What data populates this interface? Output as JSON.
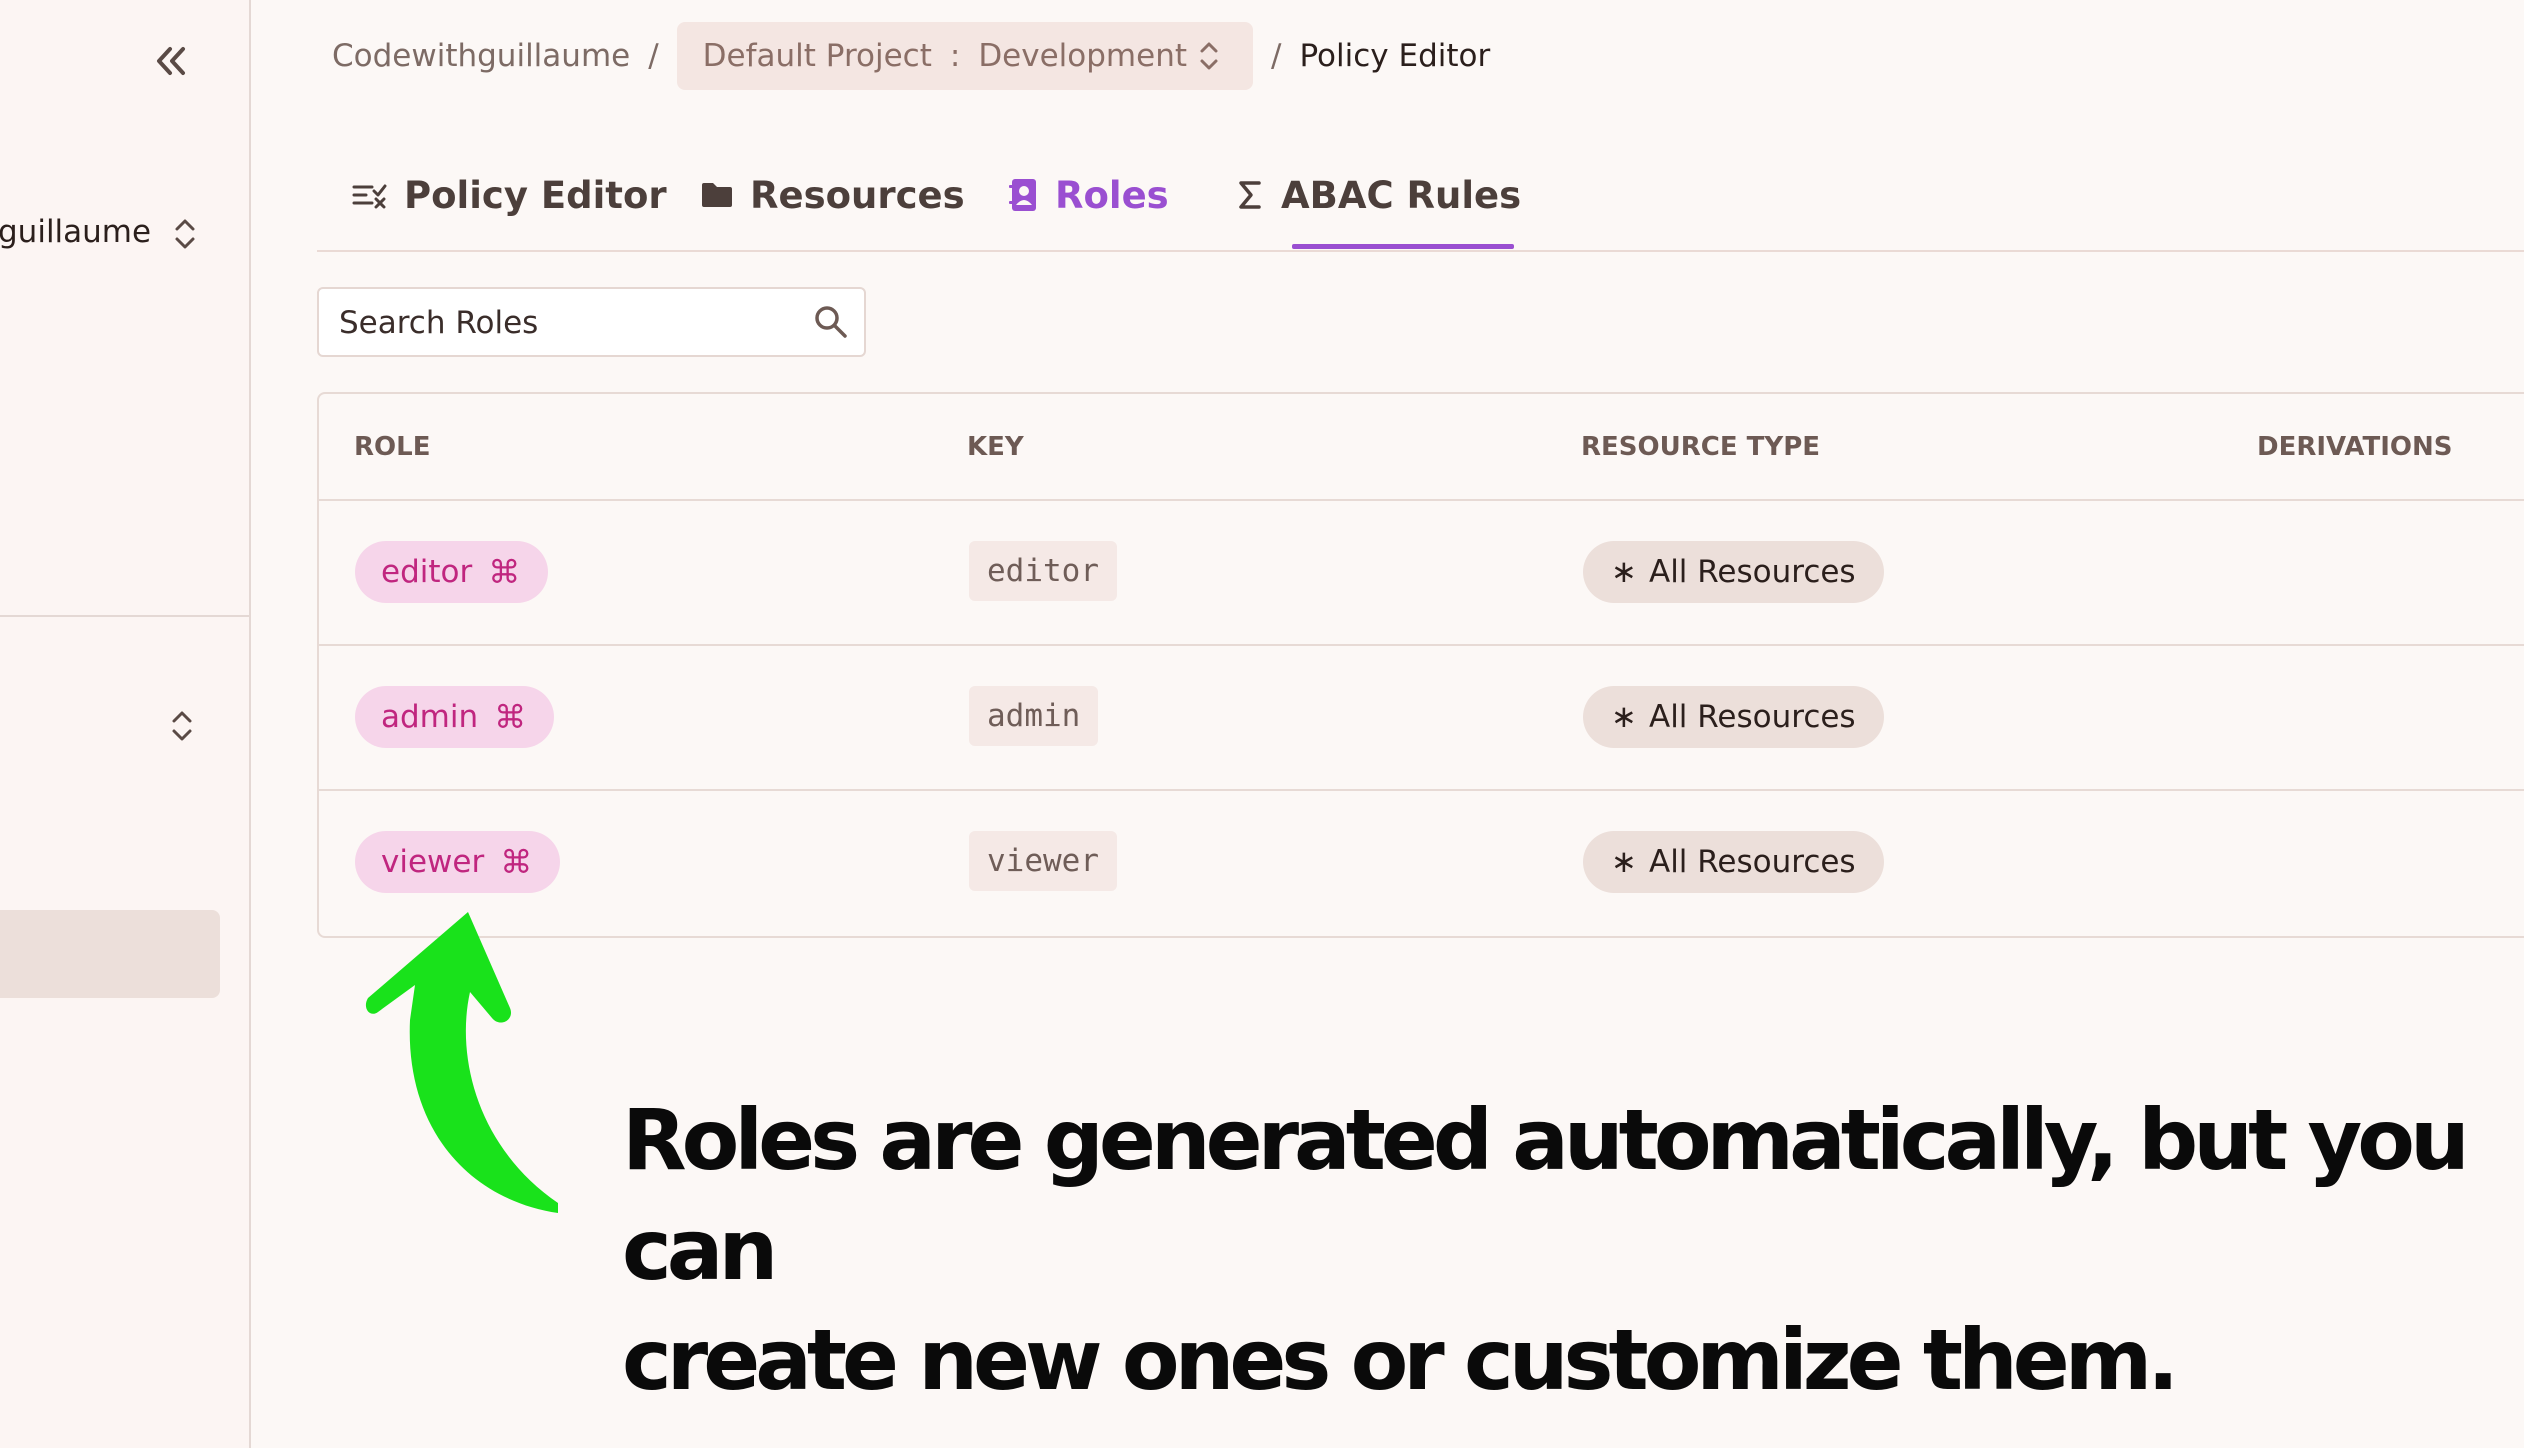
{
  "sidebar": {
    "org_name": "guillaume",
    "collapse_icon": "double-chevron-left-icon",
    "switcher_icon": "chevron-up-down-icon"
  },
  "breadcrumb": {
    "org": "Codewithguillaume",
    "separator": "/",
    "project": "Default Project",
    "project_sep": ":",
    "environment": "Development",
    "current": "Policy Editor"
  },
  "tabs": [
    {
      "label": "Policy Editor",
      "icon": "policy-icon"
    },
    {
      "label": "Resources",
      "icon": "folder-icon"
    },
    {
      "label": "Roles",
      "icon": "contact-book-icon",
      "active": true
    },
    {
      "label": "ABAC Rules",
      "icon": "sigma-icon"
    }
  ],
  "search": {
    "placeholder": "Search Roles",
    "value": ""
  },
  "table": {
    "headers": [
      "ROLE",
      "KEY",
      "RESOURCE TYPE",
      "DERIVATIONS"
    ],
    "rows": [
      {
        "role": "editor",
        "key": "editor",
        "resource_type": "All Resources"
      },
      {
        "role": "admin",
        "key": "admin",
        "resource_type": "All Resources"
      },
      {
        "role": "viewer",
        "key": "viewer",
        "resource_type": "All Resources"
      }
    ],
    "resource_prefix": "∗"
  },
  "annotation": {
    "line1": "Roles are generated automatically, but you can",
    "line2": "create new ones or customize them.",
    "arrow_color": "#19e21b"
  },
  "colors": {
    "accent": "#9a4fd1",
    "role_pill_bg": "#f6d5ea",
    "role_pill_text": "#c0267f",
    "background": "#fcf8f6"
  }
}
